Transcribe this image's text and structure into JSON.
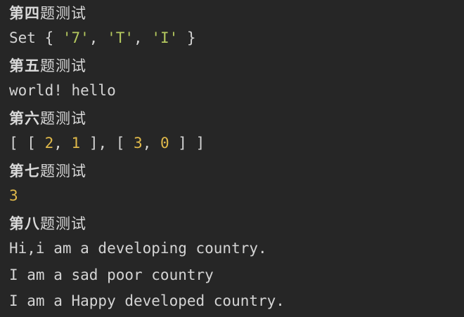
{
  "sections": [
    {
      "heading_prefix": "第四",
      "heading_suffix": "题测试",
      "output": {
        "open": "Set { ",
        "items": [
          "'7'",
          "'T'",
          "'I'"
        ],
        "sep": ", ",
        "close": " }"
      }
    },
    {
      "heading_prefix": "第五",
      "heading_suffix": "题测试",
      "output": "world! hello"
    },
    {
      "heading_prefix": "第六",
      "heading_suffix": "题测试",
      "output": {
        "t1": "[ [ ",
        "n1": "2",
        "t2": ", ",
        "n2": "1",
        "t3": " ], [ ",
        "n3": "3",
        "t4": ", ",
        "n4": "0",
        "t5": " ] ]"
      }
    },
    {
      "heading_prefix": "第七",
      "heading_suffix": "题测试",
      "output": "3"
    },
    {
      "heading_prefix": "第八",
      "heading_suffix": "题测试",
      "output_lines": [
        "Hi,i am a developing country.",
        "I am a sad poor country",
        "I am a Happy developed country."
      ]
    }
  ],
  "colors": {
    "background": "#262626",
    "text": "#d4d4d4",
    "string": "#b5c95f",
    "number": "#e0b94a"
  }
}
